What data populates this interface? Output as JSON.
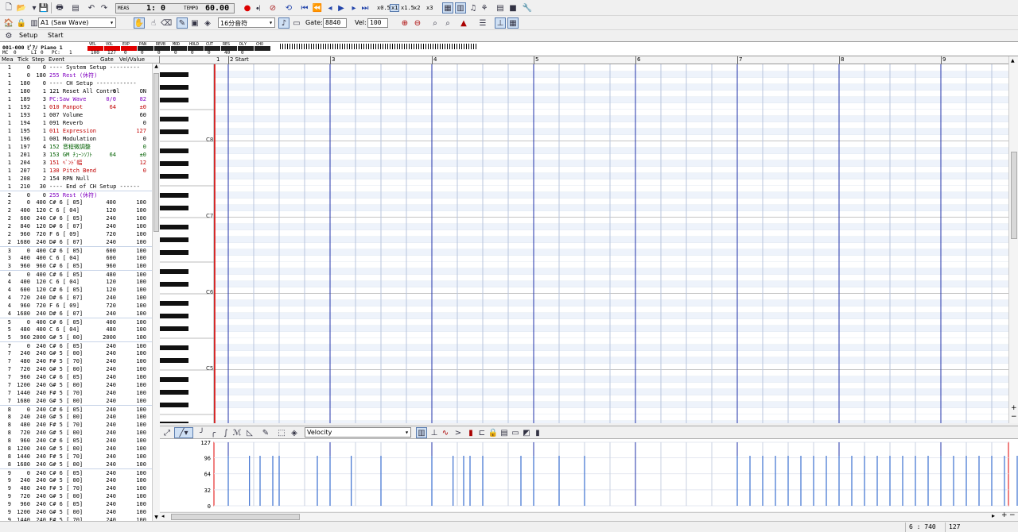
{
  "toolbar1": {
    "meas_label": "MEAS",
    "position": "1:   0",
    "tempo_label": "TEMPO",
    "tempo": "60.00",
    "speed": [
      "x0.5",
      "x1",
      "x1.5",
      "x2",
      "x3"
    ]
  },
  "toolbar2": {
    "track_select": "A1  (Saw Wave)",
    "note_length": "16分音符",
    "gate_label": "Gate:",
    "gate_value": "8840",
    "vel_label": "Vel:",
    "vel_value": "100"
  },
  "toolbar3": {
    "setup_label": "Setup",
    "start_label": "Start"
  },
  "track_header": {
    "name": "001-000 ﾋﾟｱﾉ Piano 1",
    "row2": [
      "MC",
      "0",
      "LI",
      "0",
      "PC:",
      "1"
    ],
    "params": [
      {
        "label": "VEL",
        "value": "100",
        "color": "#e00000"
      },
      {
        "label": "VOL",
        "value": "127",
        "color": "#e00000"
      },
      {
        "label": "EXP",
        "value": "0",
        "color": "#e00000"
      },
      {
        "label": "PAN",
        "value": "0",
        "color": ""
      },
      {
        "label": "REVB",
        "value": "0",
        "color": ""
      },
      {
        "label": "MOD",
        "value": "0",
        "color": ""
      },
      {
        "label": "HOLD",
        "value": "0",
        "color": ""
      },
      {
        "label": "CUT",
        "value": "0",
        "color": ""
      },
      {
        "label": "RES",
        "value": "40",
        "color": ""
      },
      {
        "label": "DLY",
        "value": "0",
        "color": ""
      },
      {
        "label": "CHO",
        "value": "",
        "color": ""
      }
    ]
  },
  "event_list": {
    "headers": [
      "Mea",
      "Tick",
      "Step",
      "Event",
      "Gate",
      "Vel/Value"
    ],
    "rows": [
      [
        "1",
        "0",
        "0",
        "---- System Setup ---------",
        "",
        "",
        "#000"
      ],
      [
        "1",
        "0",
        "180",
        "255 Rest (休符)",
        "",
        "",
        "#8000c0"
      ],
      [
        "1",
        "180",
        "0",
        "---- CH Setup ------------",
        "",
        "",
        "#000"
      ],
      [
        "1",
        "180",
        "1",
        "121 Reset All Control",
        "0",
        "ON",
        "#000"
      ],
      [
        "1",
        "189",
        "3",
        "PC:Saw Wave",
        "0/0",
        "82",
        "#8000c0"
      ],
      [
        "1",
        "192",
        "1",
        "010 Panpot",
        "64",
        "±0",
        "#c00000"
      ],
      [
        "1",
        "193",
        "1",
        "007 Volume",
        "",
        "60",
        "#000"
      ],
      [
        "1",
        "194",
        "1",
        "091 Reverb",
        "",
        "0",
        "#000"
      ],
      [
        "1",
        "195",
        "1",
        "011 Expression",
        "",
        "127",
        "#c00000"
      ],
      [
        "1",
        "196",
        "1",
        "001 Modulation",
        "",
        "0",
        "#000"
      ],
      [
        "1",
        "197",
        "4",
        "152 音程微調整",
        "",
        "0",
        "#006000"
      ],
      [
        "1",
        "201",
        "3",
        "153 GM ﾁｭｰﾝｿﾌﾄ",
        "64",
        "±0",
        "#006000"
      ],
      [
        "1",
        "204",
        "3",
        "151 ﾍﾞﾝﾄﾞ幅",
        "",
        "12",
        "#c00000"
      ],
      [
        "1",
        "207",
        "1",
        "130 Pitch Bend",
        "",
        "0",
        "#c00000"
      ],
      [
        "1",
        "208",
        "2",
        "154 RPN Null",
        "",
        "",
        "#000"
      ],
      [
        "1",
        "210",
        "30",
        "---- End of CH Setup ------",
        "",
        "",
        "#000"
      ],
      [
        "2",
        "0",
        "0",
        "255 Rest (休符)",
        "",
        "",
        "#8000c0"
      ],
      [
        "2",
        "0",
        "400",
        "C# 6 [ 05]",
        "400",
        "100",
        "#000"
      ],
      [
        "2",
        "400",
        "120",
        "C  6 [ 04]",
        "120",
        "100",
        "#000"
      ],
      [
        "2",
        "600",
        "240",
        "C# 6 [ 05]",
        "240",
        "100",
        "#000"
      ],
      [
        "2",
        "840",
        "120",
        "D# 6 [ 07]",
        "240",
        "100",
        "#000"
      ],
      [
        "2",
        "960",
        "720",
        "F  6 [ 09]",
        "720",
        "100",
        "#000"
      ],
      [
        "2",
        "1680",
        "240",
        "D# 6 [ 07]",
        "240",
        "100",
        "#000"
      ],
      [
        "3",
        "0",
        "400",
        "C# 6 [ 05]",
        "600",
        "100",
        "#000"
      ],
      [
        "3",
        "400",
        "400",
        "C  6 [ 04]",
        "600",
        "100",
        "#000"
      ],
      [
        "3",
        "960",
        "960",
        "C# 6 [ 05]",
        "960",
        "100",
        "#000"
      ],
      [
        "4",
        "0",
        "400",
        "C# 6 [ 05]",
        "480",
        "100",
        "#000"
      ],
      [
        "4",
        "400",
        "120",
        "C  6 [ 04]",
        "120",
        "100",
        "#000"
      ],
      [
        "4",
        "600",
        "120",
        "C# 6 [ 05]",
        "120",
        "100",
        "#000"
      ],
      [
        "4",
        "720",
        "240",
        "D# 6 [ 07]",
        "240",
        "100",
        "#000"
      ],
      [
        "4",
        "960",
        "720",
        "F  6 [ 09]",
        "720",
        "100",
        "#000"
      ],
      [
        "4",
        "1680",
        "240",
        "D# 6 [ 07]",
        "240",
        "100",
        "#000"
      ],
      [
        "5",
        "0",
        "400",
        "C# 6 [ 05]",
        "400",
        "100",
        "#000"
      ],
      [
        "5",
        "480",
        "400",
        "C  6 [ 04]",
        "480",
        "100",
        "#000"
      ],
      [
        "5",
        "960",
        "2000",
        "G# 5 [ 00]",
        "2000",
        "100",
        "#000"
      ],
      [
        "7",
        "0",
        "240",
        "C# 6 [ 05]",
        "240",
        "100",
        "#000"
      ],
      [
        "7",
        "240",
        "240",
        "G# 5 [ 00]",
        "240",
        "100",
        "#000"
      ],
      [
        "7",
        "480",
        "240",
        "F# 5 [ 70]",
        "240",
        "100",
        "#000"
      ],
      [
        "7",
        "720",
        "240",
        "G# 5 [ 00]",
        "240",
        "100",
        "#000"
      ],
      [
        "7",
        "960",
        "240",
        "C# 6 [ 05]",
        "240",
        "100",
        "#000"
      ],
      [
        "7",
        "1200",
        "240",
        "G# 5 [ 00]",
        "240",
        "100",
        "#000"
      ],
      [
        "7",
        "1440",
        "240",
        "F# 5 [ 70]",
        "240",
        "100",
        "#000"
      ],
      [
        "7",
        "1680",
        "240",
        "G# 5 [ 00]",
        "240",
        "100",
        "#000"
      ],
      [
        "8",
        "0",
        "240",
        "C# 6 [ 05]",
        "240",
        "100",
        "#000"
      ],
      [
        "8",
        "240",
        "240",
        "G# 5 [ 00]",
        "240",
        "100",
        "#000"
      ],
      [
        "8",
        "480",
        "240",
        "F# 5 [ 70]",
        "240",
        "100",
        "#000"
      ],
      [
        "8",
        "720",
        "240",
        "G# 5 [ 00]",
        "240",
        "100",
        "#000"
      ],
      [
        "8",
        "960",
        "240",
        "C# 6 [ 05]",
        "240",
        "100",
        "#000"
      ],
      [
        "8",
        "1200",
        "240",
        "G# 5 [ 00]",
        "240",
        "100",
        "#000"
      ],
      [
        "8",
        "1440",
        "240",
        "F# 5 [ 70]",
        "240",
        "100",
        "#000"
      ],
      [
        "8",
        "1680",
        "240",
        "G# 5 [ 00]",
        "240",
        "100",
        "#000"
      ],
      [
        "9",
        "0",
        "240",
        "C# 6 [ 05]",
        "240",
        "100",
        "#000"
      ],
      [
        "9",
        "240",
        "240",
        "G# 5 [ 00]",
        "240",
        "100",
        "#000"
      ],
      [
        "9",
        "480",
        "240",
        "F# 5 [ 70]",
        "240",
        "100",
        "#000"
      ],
      [
        "9",
        "720",
        "240",
        "G# 5 [ 00]",
        "240",
        "100",
        "#000"
      ],
      [
        "9",
        "960",
        "240",
        "C# 6 [ 05]",
        "240",
        "100",
        "#000"
      ],
      [
        "9",
        "1200",
        "240",
        "G# 5 [ 00]",
        "240",
        "100",
        "#000"
      ],
      [
        "9",
        "1440",
        "240",
        "F# 5 [ 70]",
        "240",
        "100",
        "#000"
      ]
    ]
  },
  "pianoroll": {
    "ruler": [
      "1",
      "2 Start",
      "3",
      "4",
      "5",
      "6",
      "7",
      "8",
      "9"
    ],
    "octave_labels": [
      "C8",
      "C7",
      "C6",
      "C5"
    ],
    "notes_desc": "bars in piano roll"
  },
  "controller": {
    "select": "Velocity",
    "yticks": [
      "127",
      "96",
      "64",
      "32",
      "0"
    ]
  },
  "status": {
    "position": "6 : 740",
    "value": "127"
  }
}
